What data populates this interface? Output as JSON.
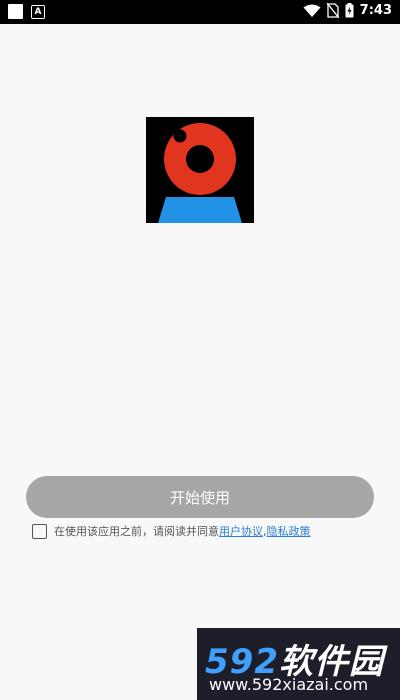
{
  "status_bar": {
    "time": "7:43",
    "left_icons": [
      "square-icon",
      "a-icon"
    ],
    "right_icons": [
      "wifi-icon",
      "no-sim-icon",
      "battery-charging-icon"
    ]
  },
  "colors": {
    "logo_red": "#e2351f",
    "logo_blue": "#2192e6",
    "button_gray": "#a6a6a6",
    "link_blue": "#2a7fd6",
    "watermark_bg": "#1e1e2a",
    "watermark_blue": "#3fa0ff"
  },
  "main": {
    "logo_icon": "camera-lens-icon",
    "start_button_label": "开始使用",
    "agreement": {
      "checked": false,
      "prefix": "在使用该应用之前，请阅读并同意 ",
      "user_agreement": "用户协议",
      "separator": ", ",
      "privacy_policy": "隐私政策"
    }
  },
  "watermark": {
    "number": "592",
    "name": "软件园",
    "url": "www.592xiazai.com"
  }
}
